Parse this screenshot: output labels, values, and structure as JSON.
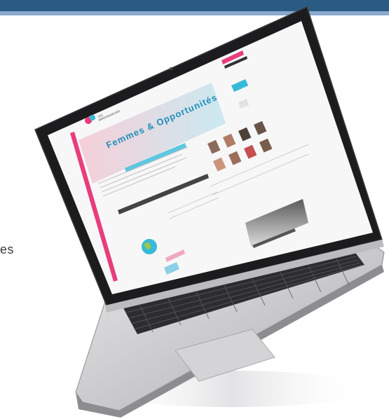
{
  "slide": {
    "side_text": "es"
  },
  "website": {
    "logo_text_line1": "LES",
    "logo_text_line2": "AMBASSADEURS",
    "header_badge": "",
    "banner_title": "Femmes & Opportunités",
    "colors": {
      "top_bar": "#2b5b82",
      "top_bar_accent": "#89a9cf",
      "site_accent_pink": "#e83d7c",
      "site_accent_cyan": "#37b9d9",
      "laptop_bezel": "#1c1c1e",
      "laptop_body": "#c9c9cb"
    }
  },
  "laptop": {
    "description_icon": "laptop-icon"
  }
}
